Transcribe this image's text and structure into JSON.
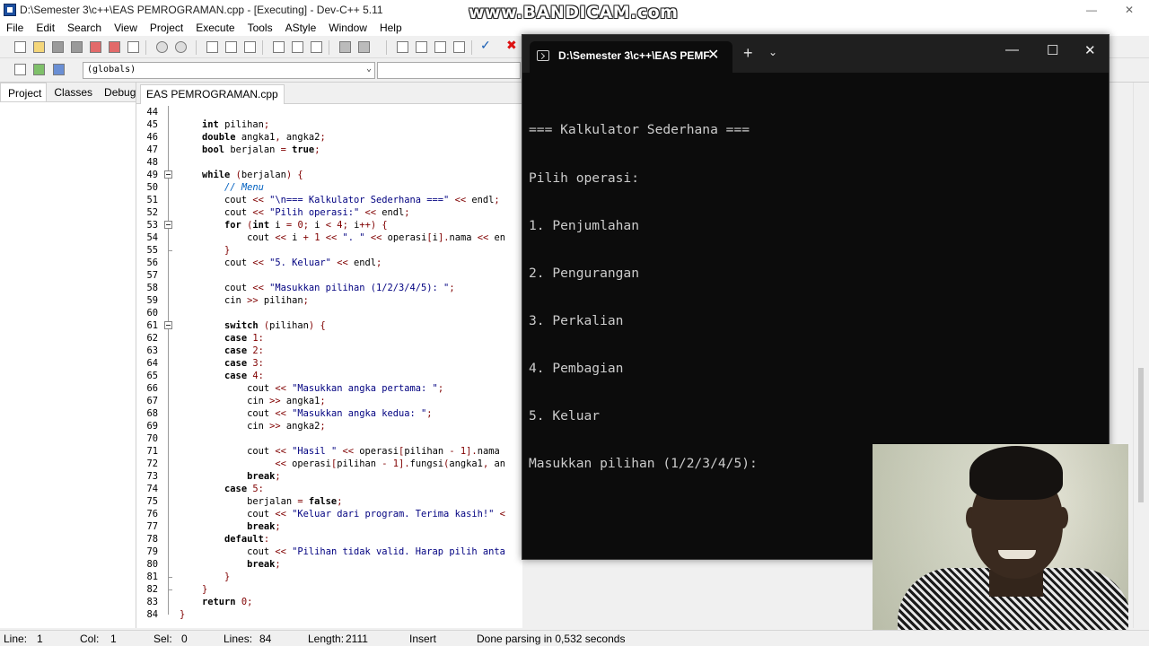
{
  "window": {
    "title": "D:\\Semester 3\\c++\\EAS PEMROGRAMAN.cpp - [Executing] - Dev-C++ 5.11"
  },
  "watermark": "www.BANDICAM.com",
  "menu": [
    "File",
    "Edit",
    "Search",
    "View",
    "Project",
    "Execute",
    "Tools",
    "AStyle",
    "Window",
    "Help"
  ],
  "toolbar": {
    "scope_value": "(globals)"
  },
  "left_panel": {
    "tabs": [
      "Project",
      "Classes",
      "Debug"
    ]
  },
  "editor": {
    "tab": "EAS PEMROGRAMAN.cpp",
    "lines": [
      {
        "n": "44",
        "t": ""
      },
      {
        "n": "45",
        "t": "    int pilihan;"
      },
      {
        "n": "46",
        "t": "    double angka1, angka2;"
      },
      {
        "n": "47",
        "t": "    bool berjalan = true;"
      },
      {
        "n": "48",
        "t": ""
      },
      {
        "n": "49",
        "t": "    while (berjalan) {"
      },
      {
        "n": "50",
        "t": "        // Menu"
      },
      {
        "n": "51",
        "t": "        cout << \"\\n=== Kalkulator Sederhana ===\" << endl;"
      },
      {
        "n": "52",
        "t": "        cout << \"Pilih operasi:\" << endl;"
      },
      {
        "n": "53",
        "t": "        for (int i = 0; i < 4; i++) {"
      },
      {
        "n": "54",
        "t": "            cout << i + 1 << \". \" << operasi[i].nama << en"
      },
      {
        "n": "55",
        "t": "        }"
      },
      {
        "n": "56",
        "t": "        cout << \"5. Keluar\" << endl;"
      },
      {
        "n": "57",
        "t": ""
      },
      {
        "n": "58",
        "t": "        cout << \"Masukkan pilihan (1/2/3/4/5): \";"
      },
      {
        "n": "59",
        "t": "        cin >> pilihan;"
      },
      {
        "n": "60",
        "t": ""
      },
      {
        "n": "61",
        "t": "        switch (pilihan) {"
      },
      {
        "n": "62",
        "t": "        case 1:"
      },
      {
        "n": "63",
        "t": "        case 2:"
      },
      {
        "n": "64",
        "t": "        case 3:"
      },
      {
        "n": "65",
        "t": "        case 4:"
      },
      {
        "n": "66",
        "t": "            cout << \"Masukkan angka pertama: \";"
      },
      {
        "n": "67",
        "t": "            cin >> angka1;"
      },
      {
        "n": "68",
        "t": "            cout << \"Masukkan angka kedua: \";"
      },
      {
        "n": "69",
        "t": "            cin >> angka2;"
      },
      {
        "n": "70",
        "t": ""
      },
      {
        "n": "71",
        "t": "            cout << \"Hasil \" << operasi[pilihan - 1].nama"
      },
      {
        "n": "72",
        "t": "                 << operasi[pilihan - 1].fungsi(angka1, an"
      },
      {
        "n": "73",
        "t": "            break;"
      },
      {
        "n": "74",
        "t": "        case 5:"
      },
      {
        "n": "75",
        "t": "            berjalan = false;"
      },
      {
        "n": "76",
        "t": "            cout << \"Keluar dari program. Terima kasih!\" <"
      },
      {
        "n": "77",
        "t": "            break;"
      },
      {
        "n": "78",
        "t": "        default:"
      },
      {
        "n": "79",
        "t": "            cout << \"Pilihan tidak valid. Harap pilih anta"
      },
      {
        "n": "80",
        "t": "            break;"
      },
      {
        "n": "81",
        "t": "        }"
      },
      {
        "n": "82",
        "t": "    }"
      },
      {
        "n": "83",
        "t": "    return 0;"
      },
      {
        "n": "84",
        "t": "}"
      }
    ]
  },
  "console": {
    "tab_title": "D:\\Semester 3\\c++\\EAS PEMF",
    "close_glyph": "✕",
    "new_tab_glyph": "+",
    "dropdown_glyph": "⌄",
    "output": [
      "=== Kalkulator Sederhana ===",
      "Pilih operasi:",
      "1. Penjumlahan",
      "2. Pengurangan",
      "3. Perkalian",
      "4. Pembagian",
      "5. Keluar",
      "Masukkan pilihan (1/2/3/4/5):"
    ]
  },
  "statusbar": {
    "line_label": "Line:",
    "line_value": "1",
    "col_label": "Col:",
    "col_value": "1",
    "sel_label": "Sel:",
    "sel_value": "0",
    "lines_label": "Lines:",
    "lines_value": "84",
    "length_label": "Length:",
    "length_value": "2111",
    "mode": "Insert",
    "message": "Done parsing in 0,532 seconds"
  },
  "colors": {
    "keyword": "#000000",
    "string": "#000080",
    "number": "#800000",
    "comment": "#0060c0",
    "symbol": "#800000",
    "console_bg": "#0c0c0c",
    "console_text": "#cccccc"
  }
}
